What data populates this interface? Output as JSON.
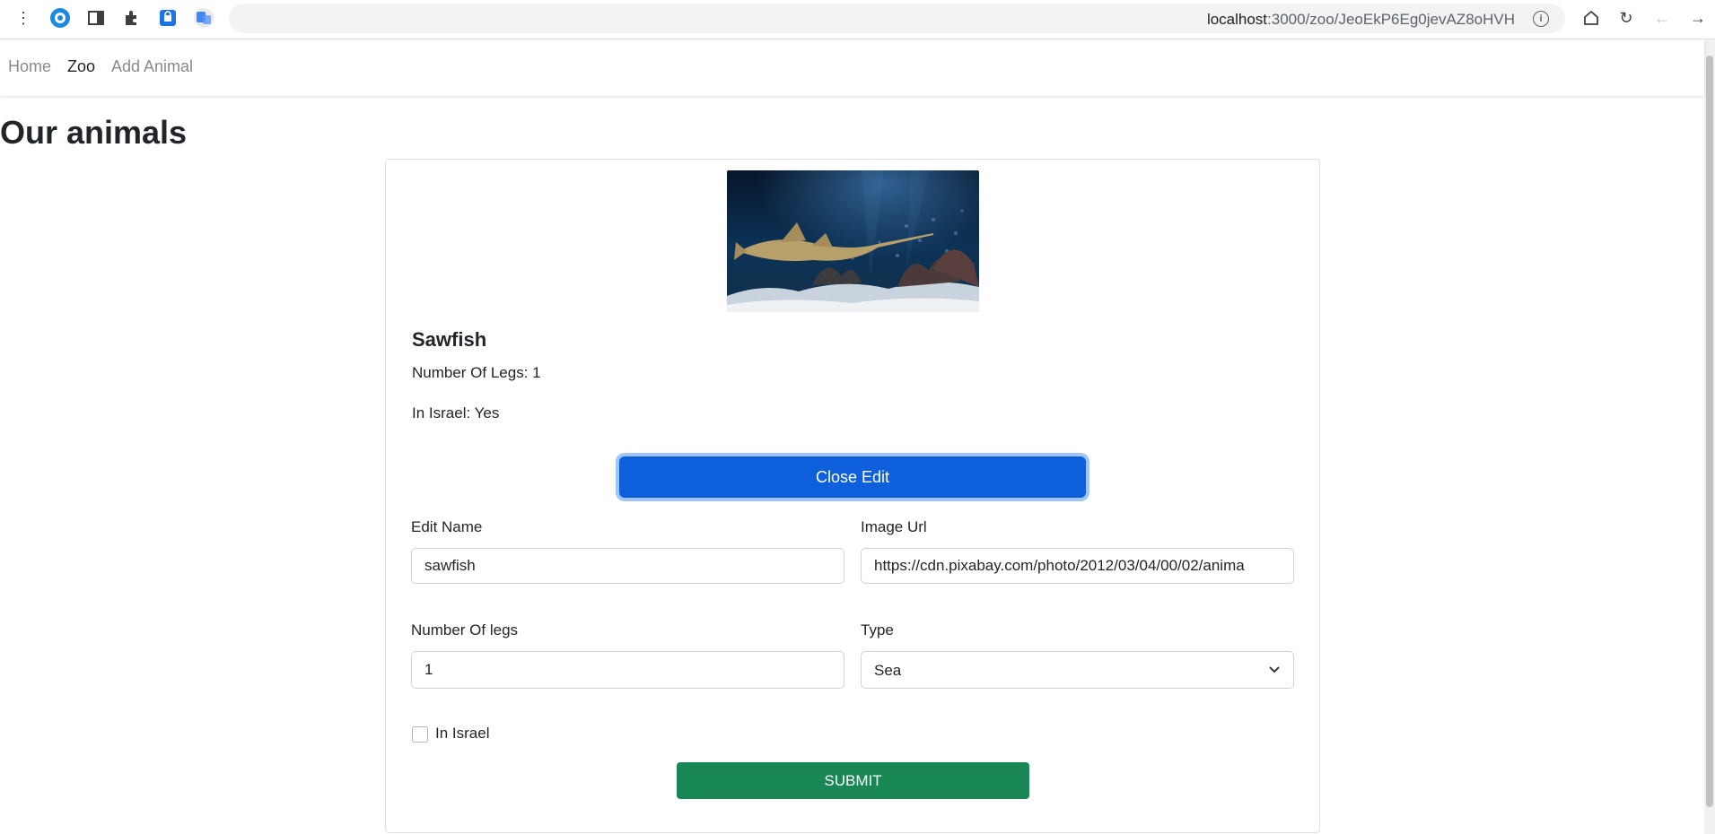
{
  "browser": {
    "url_host": "localhost",
    "url_path": ":3000/zoo/JeoEkP6Eg0jevAZ8oHVH",
    "info_glyph": "i"
  },
  "navbar": {
    "links": [
      {
        "label": "Home"
      },
      {
        "label": "Zoo"
      },
      {
        "label": "Add Animal"
      }
    ],
    "active": "Zoo"
  },
  "page": {
    "title": "Our animals"
  },
  "animal": {
    "name": "Sawfish",
    "legs_text": "Number Of Legs: 1",
    "israel_text": "In Israel: Yes"
  },
  "edit": {
    "close_label": "Close Edit",
    "name_label": "Edit Name",
    "name_value": "sawfish",
    "image_label": "Image Url",
    "image_value": "https://cdn.pixabay.com/photo/2012/03/04/00/02/anima",
    "legs_label": "Number Of legs",
    "legs_value": "1",
    "type_label": "Type",
    "type_value": "Sea",
    "israel_label": "In Israel",
    "israel_checked": false,
    "submit_label": "SUBMIT"
  },
  "colors": {
    "primary": "#0d5fdb",
    "success": "#198754"
  }
}
